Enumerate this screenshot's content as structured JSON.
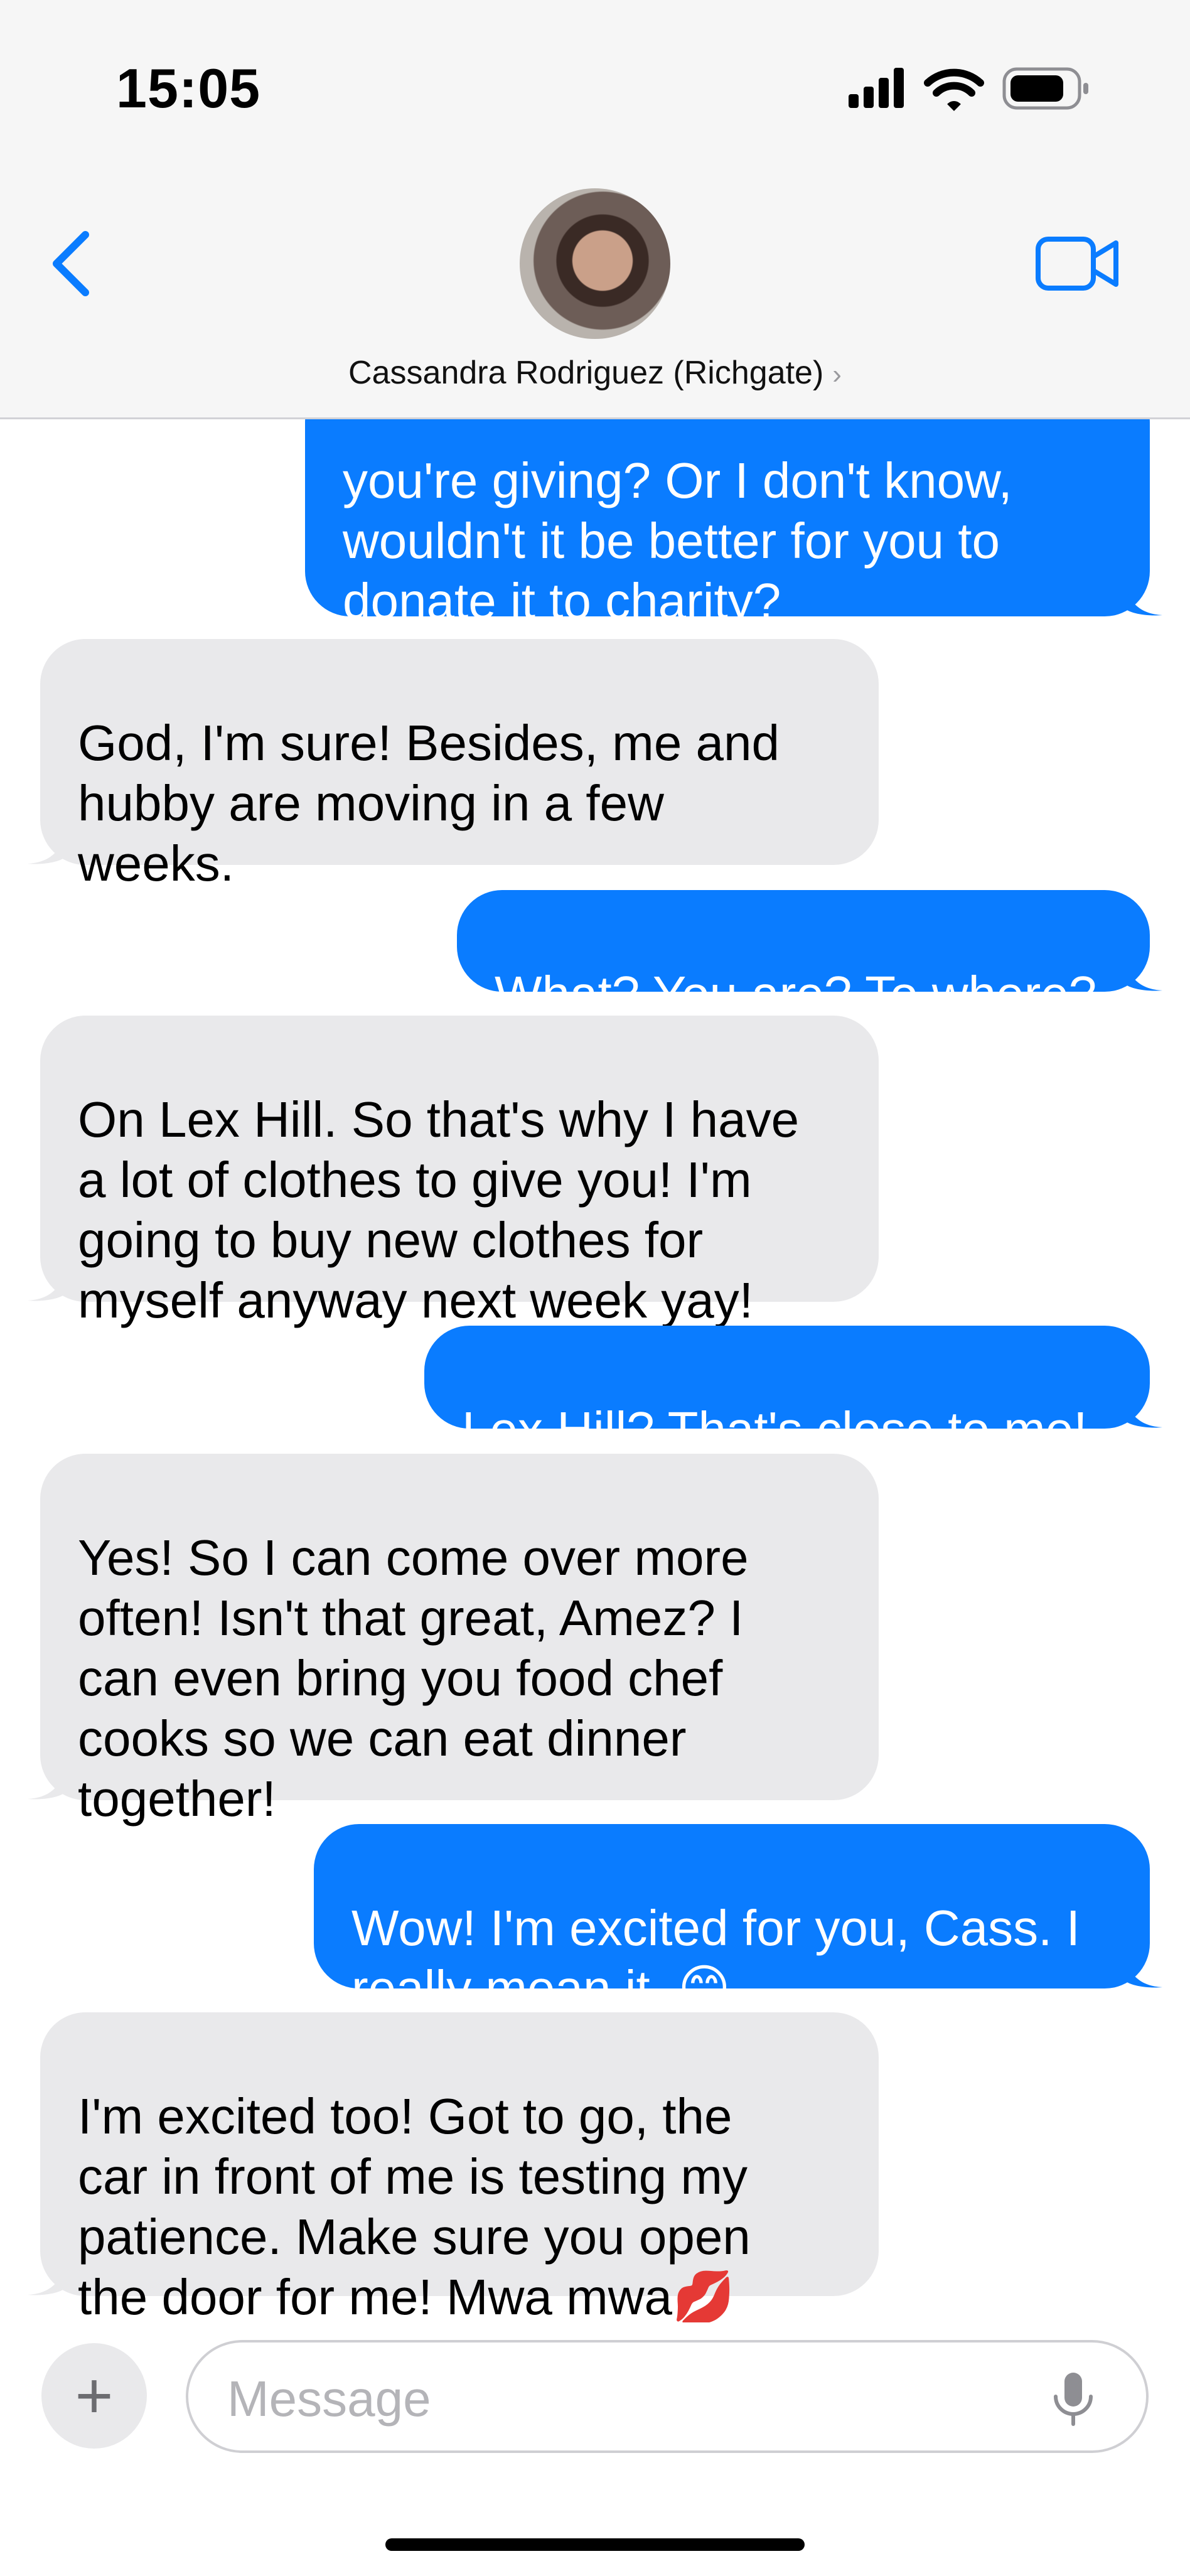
{
  "status_bar": {
    "time": "15:05",
    "signal_icon": "cellular-signal-icon",
    "wifi_icon": "wifi-icon",
    "battery_icon": "battery-icon"
  },
  "header": {
    "back_icon": "chevron-left-icon",
    "contact_name": "Cassandra Rodriguez (Richgate)",
    "contact_chevron": "›",
    "video_icon": "video-camera-icon",
    "accent_color": "#0a7cff"
  },
  "messages": [
    {
      "direction": "sent",
      "text": "you're giving? Or I don't know,\nwouldn't it be better for you to\ndonate it to charity?"
    },
    {
      "direction": "received",
      "text": "God, I'm sure! Besides, me and\nhubby are moving in a few\nweeks."
    },
    {
      "direction": "sent",
      "text": "What? You are? To where?"
    },
    {
      "direction": "received",
      "text": "On Lex Hill. So that's why I have\na lot of clothes to give you! I'm\ngoing to buy new clothes for\nmyself anyway next week yay!"
    },
    {
      "direction": "sent",
      "text": "Lex Hill? That's close to me!"
    },
    {
      "direction": "received",
      "text": "Yes! So I can come over more\noften! Isn't that great, Amez? I\ncan even bring you food chef\ncooks so we can eat dinner\ntogether!"
    },
    {
      "direction": "sent",
      "text": "Wow! I'm excited for you, Cass. I\nreally mean it. 😊"
    },
    {
      "direction": "received",
      "text": "I'm excited too! Got to go, the\ncar in front of me is testing my\npatience. Make sure you open\nthe door for me! Mwa mwa💋"
    }
  ],
  "input": {
    "plus_label": "+",
    "placeholder": "Message",
    "mic_icon": "microphone-icon"
  },
  "colors": {
    "sent_bubble": "#0a7cff",
    "received_bubble": "#e9e9eb",
    "header_bg": "#f6f6f6"
  }
}
